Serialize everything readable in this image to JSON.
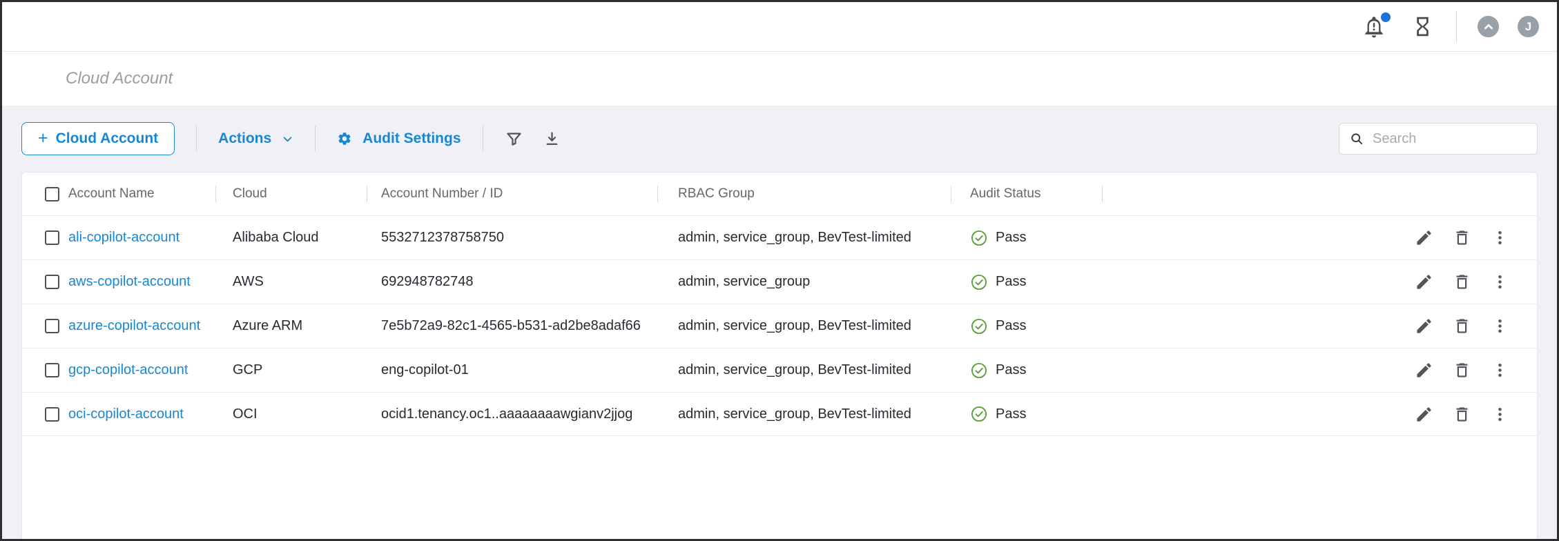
{
  "topbar": {
    "avatar_initial": "J"
  },
  "breadcrumb": {
    "label": "Cloud Account"
  },
  "toolbar": {
    "add_plus": "+",
    "add_label": "Cloud Account",
    "actions_label": "Actions",
    "audit_settings_label": "Audit Settings",
    "search_placeholder": "Search"
  },
  "table": {
    "columns": {
      "name": "Account Name",
      "cloud": "Cloud",
      "id": "Account Number / ID",
      "rbac": "RBAC Group",
      "audit": "Audit Status"
    },
    "rows": [
      {
        "name": "ali-copilot-account",
        "cloud": "Alibaba Cloud",
        "id": "5532712378758750",
        "rbac": "admin, service_group, BevTest-limited",
        "audit": "Pass"
      },
      {
        "name": "aws-copilot-account",
        "cloud": "AWS",
        "id": "692948782748",
        "rbac": "admin, service_group",
        "audit": "Pass"
      },
      {
        "name": "azure-copilot-account",
        "cloud": "Azure ARM",
        "id": "7e5b72a9-82c1-4565-b531-ad2be8adaf66",
        "rbac": "admin, service_group, BevTest-limited",
        "audit": "Pass"
      },
      {
        "name": "gcp-copilot-account",
        "cloud": "GCP",
        "id": "eng-copilot-01",
        "rbac": "admin, service_group, BevTest-limited",
        "audit": "Pass"
      },
      {
        "name": "oci-copilot-account",
        "cloud": "OCI",
        "id": "ocid1.tenancy.oc1..aaaaaaaawgianv2jjog",
        "rbac": "admin, service_group, BevTest-limited",
        "audit": "Pass"
      }
    ]
  },
  "icons": {
    "notification-bell": "bell with exclamation",
    "hourglass": "task history",
    "app-launcher": "chevron-up circle",
    "user-avatar": "J circle",
    "gear": "audit settings",
    "filter": "funnel",
    "download": "arrow-down tray",
    "search": "magnifier",
    "chevron-down": "actions menu",
    "check-circle": "pass status",
    "edit": "pencil",
    "delete": "trash",
    "more": "kebab dots"
  },
  "colors": {
    "accent_blue": "#1787d3",
    "pass_green": "#5ba33b",
    "notification_dot": "#1c74d9",
    "page_bg": "#f0f1f6",
    "avatar_gray": "#9aa0a8"
  }
}
